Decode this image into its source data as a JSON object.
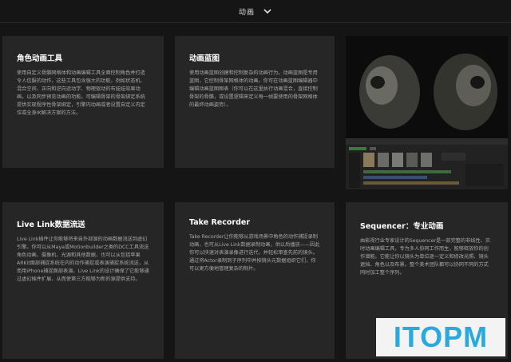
{
  "header": {
    "title": "动画",
    "chevron_icon": "chevron-down-icon"
  },
  "cards": [
    {
      "title": "角色动画工具",
      "body": "使用自定义骨骼网格体和动画编辑工具全面控制角色并打造令人信服的动作，这些工具包含强大的功能，例如状态机、混合空间、正向和逆向运动学、物理驱动的布娃娃效果动画，以及同步预览动画的功能。可编辑骨架的骨架绑定系统提供实现程序性骨架绑定，引擎内动画或者设置自定义内定位或全身IK解决方案的方法。"
    },
    {
      "title": "动画蓝图",
      "body": "使用动画蓝图创建和控制复杂的动画行为。动画蓝图是专用蓝图，它控制骨架网格体的动画。你可在动画蓝图编辑器中编辑动画蓝图图表（你可以在这里执行动画混合，直接控制骨架的骨骼，或设置逻辑来定义每一帧要使用的骨架网格体的最终动画姿势）。"
    },
    {
      "title": "Live Link数据流送",
      "body": "Live Link插件让你能够将来自外部源的动画数据流送到虚幻引擎。你可以从Maya或Motionbuilder之类的DCC工具流送角色动画、摄像机、光源和其他数据，也可以从包括苹果ARKit面部捕捉系统在内的动作捕捉或表演捕捉系统流送，从而用iPhone捕捉面部表演。Live Link的设计确保了它能够通过虚幻插件扩展，从而使第三方能够为新的源提供支持。"
    },
    {
      "title": "Take Recorder",
      "body": "Take Recorder让你能够从游戏场景中角色的动作捕捉录制动画，也可从Live Link数据录制动画，供以后播放——因此你可以快速对表演录像进行迭代，并轻松审查先前的镜头。通过将Actor录制到子序列中并按镜头元数据组织它们，你可以更方便地管理复杂的制片。"
    },
    {
      "title": "Sequencer：专业动画",
      "body": "由影视行业专家设计的Sequencer是一款完整的非线性、实时动画编辑工具，专为多人协同工作而生，能够释放你的创作潜能。它能让你以镜头为单位逐一定义和修改光照、镜头遮挡、角色以及布景。整个美术团队都可以协同不同的方式同时加工整个序列。"
    }
  ],
  "logo": {
    "text": "ITOPM",
    "color": "#2aa9df"
  }
}
